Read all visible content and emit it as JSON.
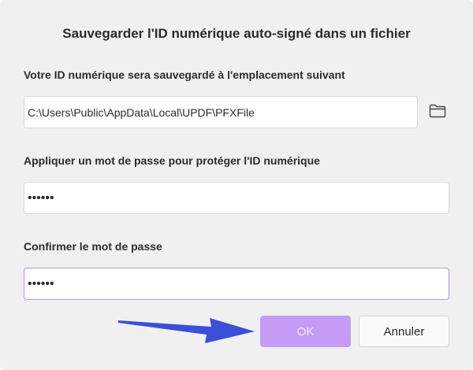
{
  "dialog": {
    "title": "Sauvegarder l'ID numérique auto-signé dans un fichier"
  },
  "path_section": {
    "label": "Votre ID numérique sera sauvegardé à l'emplacement suivant",
    "value": "C:\\Users\\Public\\AppData\\Local\\UPDF\\PFXFile",
    "browse_icon": "folder-icon"
  },
  "password_section": {
    "label": "Appliquer un mot de passe pour protéger l'ID numérique",
    "value": "••••••"
  },
  "confirm_section": {
    "label": "Confirmer le mot de passe",
    "value": "••••••"
  },
  "buttons": {
    "ok_label": "OK",
    "cancel_label": "Annuler"
  },
  "colors": {
    "ok_background": "#c49cf5",
    "focused_border": "#b690f0",
    "annotation_arrow": "#3b4fd8"
  }
}
